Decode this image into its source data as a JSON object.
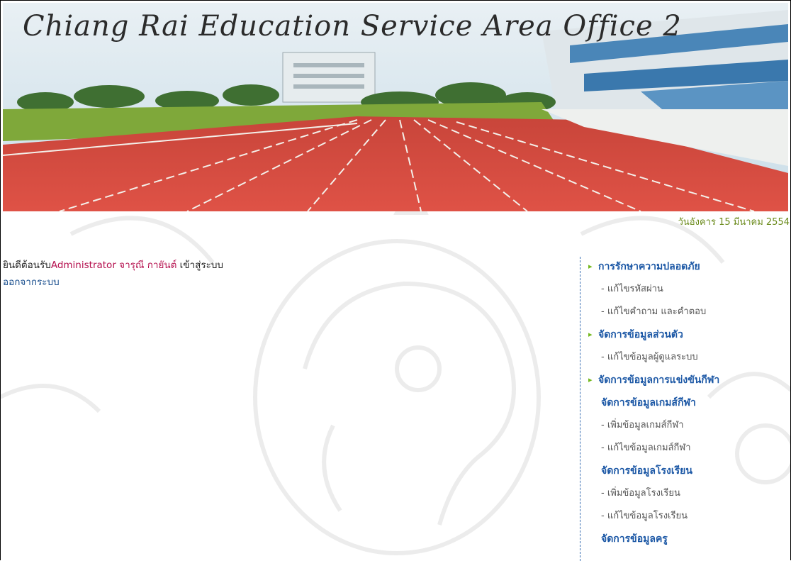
{
  "banner": {
    "title": "Chiang Rai Education Service Area Office 2"
  },
  "date_text": "วันอังคาร 15 มีนาคม 2554",
  "welcome": {
    "prefix": "ยินดีต้อนรับ",
    "user": "Administrator จารุณี กายันต์",
    "suffix": " เข้าสู่ระบบ"
  },
  "logout_label": "ออกจากระบบ",
  "menu": [
    {
      "type": "section",
      "label": "การรักษาความปลอดภัย"
    },
    {
      "type": "item",
      "label": "- แก้ไขรหัสผ่าน"
    },
    {
      "type": "item",
      "label": "- แก้ไขคำถาม และคำตอบ"
    },
    {
      "type": "section",
      "label": "จัดการข้อมูลส่วนตัว"
    },
    {
      "type": "item",
      "label": "- แก้ไขข้อมูลผู้ดูแลระบบ"
    },
    {
      "type": "section",
      "label": "จัดการข้อมูลการแข่งขันกีฬา"
    },
    {
      "type": "subhead",
      "label": "จัดการข้อมูลเกมส์กีฬา"
    },
    {
      "type": "item",
      "label": "- เพิ่มข้อมูลเกมส์กีฬา"
    },
    {
      "type": "item",
      "label": "- แก้ไขข้อมูลเกมส์กีฬา"
    },
    {
      "type": "subhead",
      "label": "จัดการข้อมูลโรงเรียน"
    },
    {
      "type": "item",
      "label": "- เพิ่มข้อมูลโรงเรียน"
    },
    {
      "type": "item",
      "label": "- แก้ไขข้อมูลโรงเรียน"
    },
    {
      "type": "subhead",
      "label": "จัดการข้อมูลครู"
    }
  ],
  "colors": {
    "track": "#d9463c",
    "grass": "#7fa83a",
    "sky": "#cfe3ee",
    "menu_heading": "#1b57a5",
    "bullet": "#74b81e",
    "user_name": "#b5104e",
    "date": "#6a8a1a"
  }
}
